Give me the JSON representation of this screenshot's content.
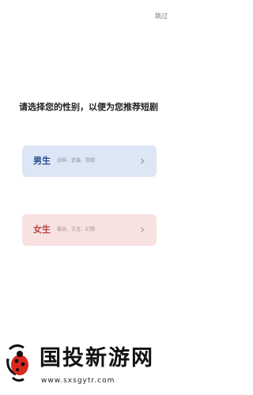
{
  "header": {
    "skip_label": "跳过"
  },
  "prompt": {
    "text": "请选择您的性别，以便为您推荐短剧"
  },
  "options": [
    {
      "title": "男生",
      "tags": "战神、逆袭、赘婿",
      "color": "#dce6f5"
    },
    {
      "title": "女生",
      "tags": "霸总、古言、幻想",
      "color": "#f8e1e1"
    }
  ],
  "watermark": {
    "brand": "国投新游网",
    "url": "www.sxsgytr.com",
    "logo_icon": "ladybug-logo-icon"
  }
}
